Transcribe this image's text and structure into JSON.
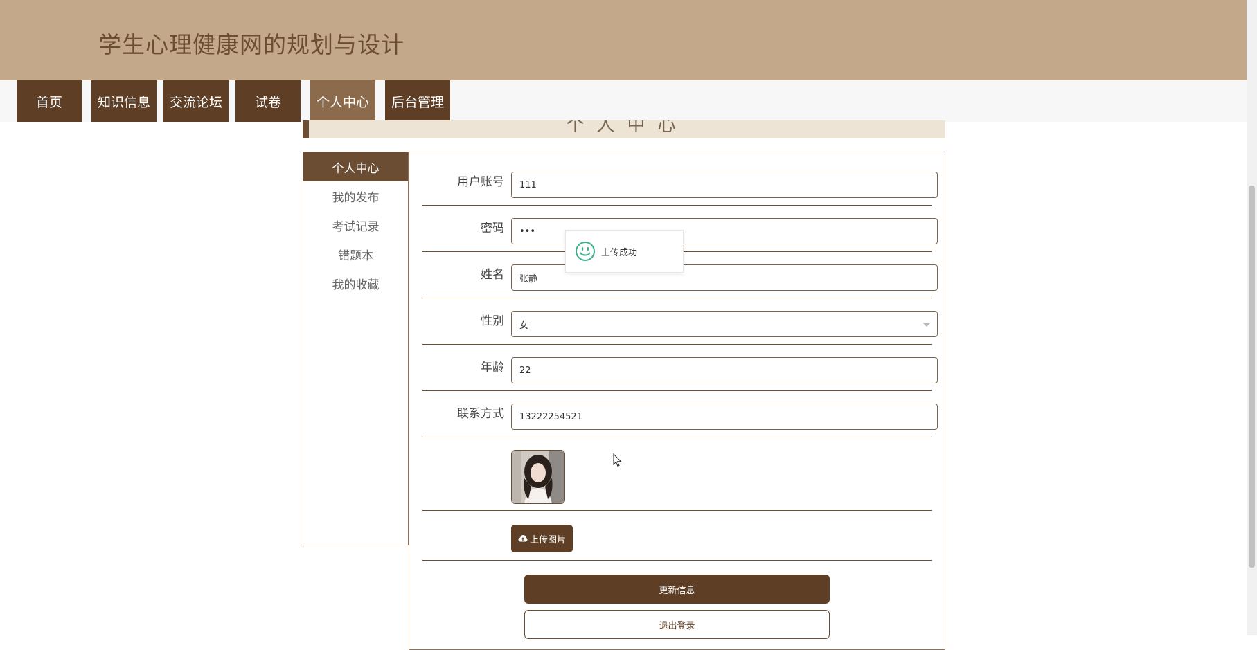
{
  "header": {
    "site_title": "学生心理健康网的规划与设计"
  },
  "nav": {
    "items": [
      {
        "label": "首页",
        "name": "home"
      },
      {
        "label": "知识信息",
        "name": "knowledge"
      },
      {
        "label": "交流论坛",
        "name": "forum"
      },
      {
        "label": "试卷",
        "name": "exam"
      },
      {
        "label": "个人中心",
        "name": "personal-center"
      },
      {
        "label": "后台管理",
        "name": "admin"
      }
    ],
    "active": "个人中心"
  },
  "banner": {
    "title": "个人中心"
  },
  "sidebar": {
    "items": [
      {
        "label": "个人中心"
      },
      {
        "label": "我的发布"
      },
      {
        "label": "考试记录"
      },
      {
        "label": "错题本"
      },
      {
        "label": "我的收藏"
      }
    ],
    "active": "个人中心"
  },
  "form": {
    "account": {
      "label": "用户账号",
      "value": "111"
    },
    "password": {
      "label": "密码",
      "value": "•••"
    },
    "name": {
      "label": "姓名",
      "value": "张静"
    },
    "gender": {
      "label": "性别",
      "value": "女"
    },
    "age": {
      "label": "年龄",
      "value": "22"
    },
    "phone": {
      "label": "联系方式",
      "value": "13222254521"
    },
    "upload_label": "上传图片",
    "update_label": "更新信息",
    "logout_label": "退出登录"
  },
  "toast": {
    "message": "上传成功",
    "icon": "smile-icon"
  },
  "colors": {
    "header_bg": "#c3a88a",
    "nav_bg": "#5e3f25",
    "nav_active_bg": "#8c6a4c",
    "accent": "#6b4d33",
    "toast_icon": "#3cb08a"
  }
}
